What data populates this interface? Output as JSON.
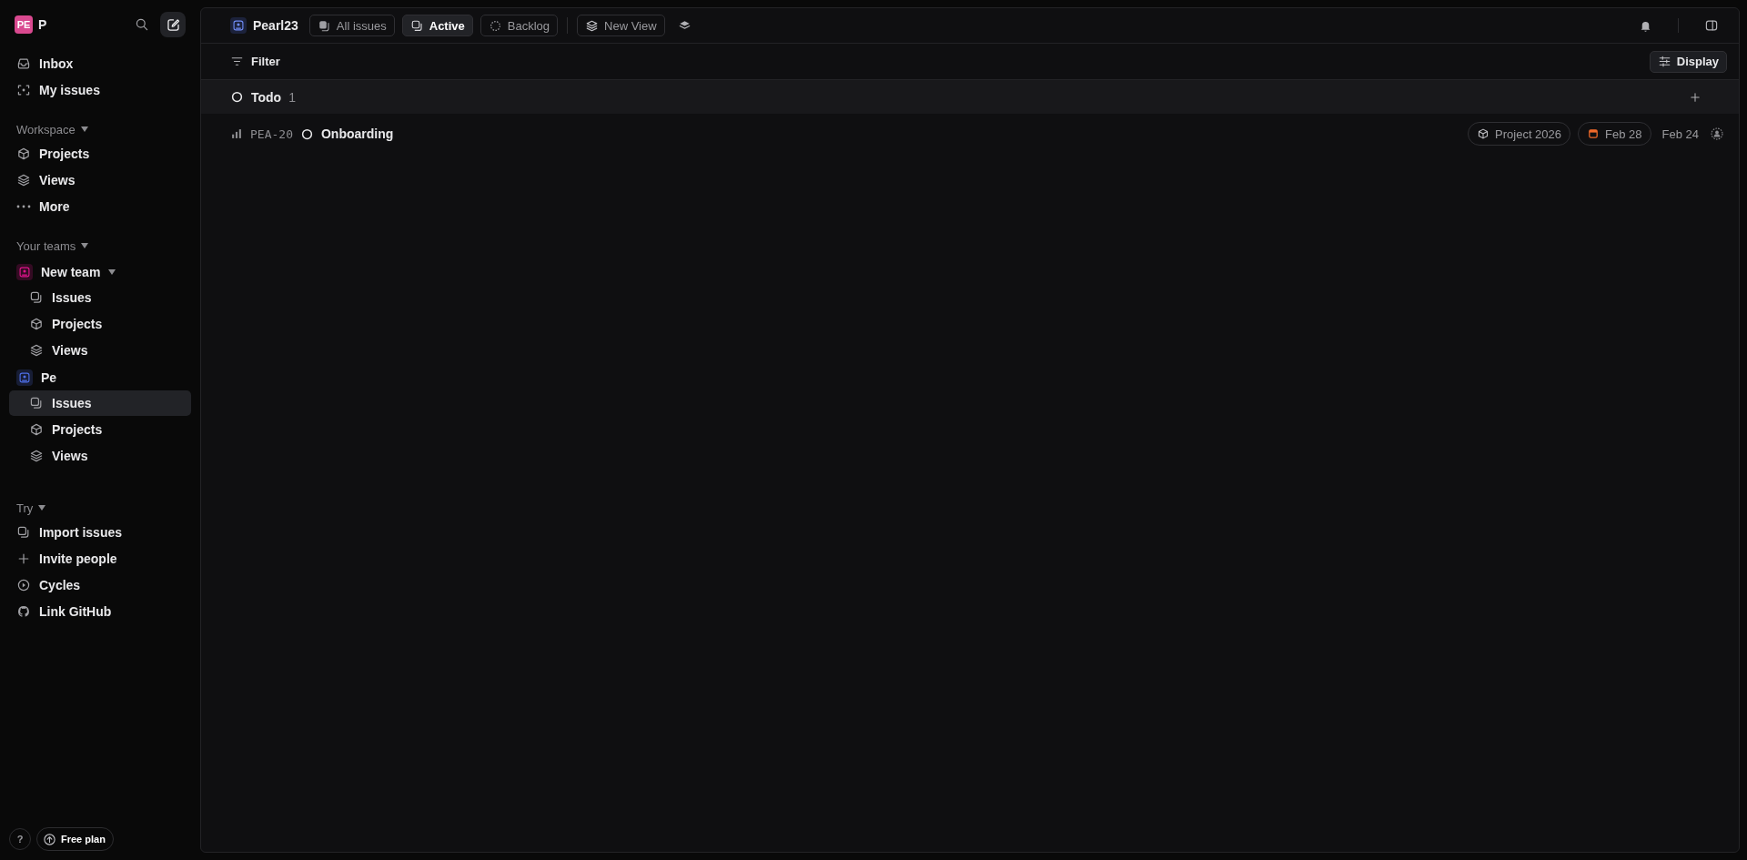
{
  "workspace": {
    "avatar": "PE",
    "name": "P"
  },
  "sidebar": {
    "top_items": [
      {
        "kind": "inbox",
        "label": "Inbox"
      },
      {
        "kind": "mine",
        "label": "My issues"
      }
    ],
    "workspace_section": {
      "title": "Workspace",
      "items": [
        {
          "kind": "projects",
          "label": "Projects"
        },
        {
          "kind": "views",
          "label": "Views"
        },
        {
          "kind": "more",
          "label": "More"
        }
      ]
    },
    "teams_section": {
      "title": "Your teams",
      "teams": [
        {
          "name": "New team",
          "color": "#e0148c",
          "caret": true,
          "items": [
            {
              "kind": "issues",
              "label": "Issues",
              "selected": false
            },
            {
              "kind": "projects",
              "label": "Projects",
              "selected": false
            },
            {
              "kind": "views",
              "label": "Views",
              "selected": false
            }
          ]
        },
        {
          "name": "Pe",
          "color": "#4f6fe8",
          "caret": false,
          "items": [
            {
              "kind": "issues",
              "label": "Issues",
              "selected": true
            },
            {
              "kind": "projects",
              "label": "Projects",
              "selected": false
            },
            {
              "kind": "views",
              "label": "Views",
              "selected": false
            }
          ]
        }
      ]
    },
    "try_section": {
      "title": "Try",
      "items": [
        {
          "kind": "import",
          "label": "Import issues"
        },
        {
          "kind": "invite",
          "label": "Invite people"
        },
        {
          "kind": "cycles",
          "label": "Cycles"
        },
        {
          "kind": "github",
          "label": "Link GitHub"
        }
      ]
    },
    "footer": {
      "help": "?",
      "plan": "Free plan"
    }
  },
  "header": {
    "team": "Pearl23",
    "tabs": [
      {
        "kind": "all",
        "label": "All issues",
        "selected": false
      },
      {
        "kind": "active",
        "label": "Active",
        "selected": true
      },
      {
        "kind": "backlog",
        "label": "Backlog",
        "selected": false
      }
    ],
    "new_view": "New View"
  },
  "toolbar": {
    "filter": "Filter",
    "display": "Display"
  },
  "groups": [
    {
      "status": "Todo",
      "count": "1",
      "issues": [
        {
          "id": "PEA-20",
          "title": "Onboarding",
          "project": "Project 2026",
          "due": "Feb 28",
          "created": "Feb 24"
        }
      ]
    }
  ]
}
